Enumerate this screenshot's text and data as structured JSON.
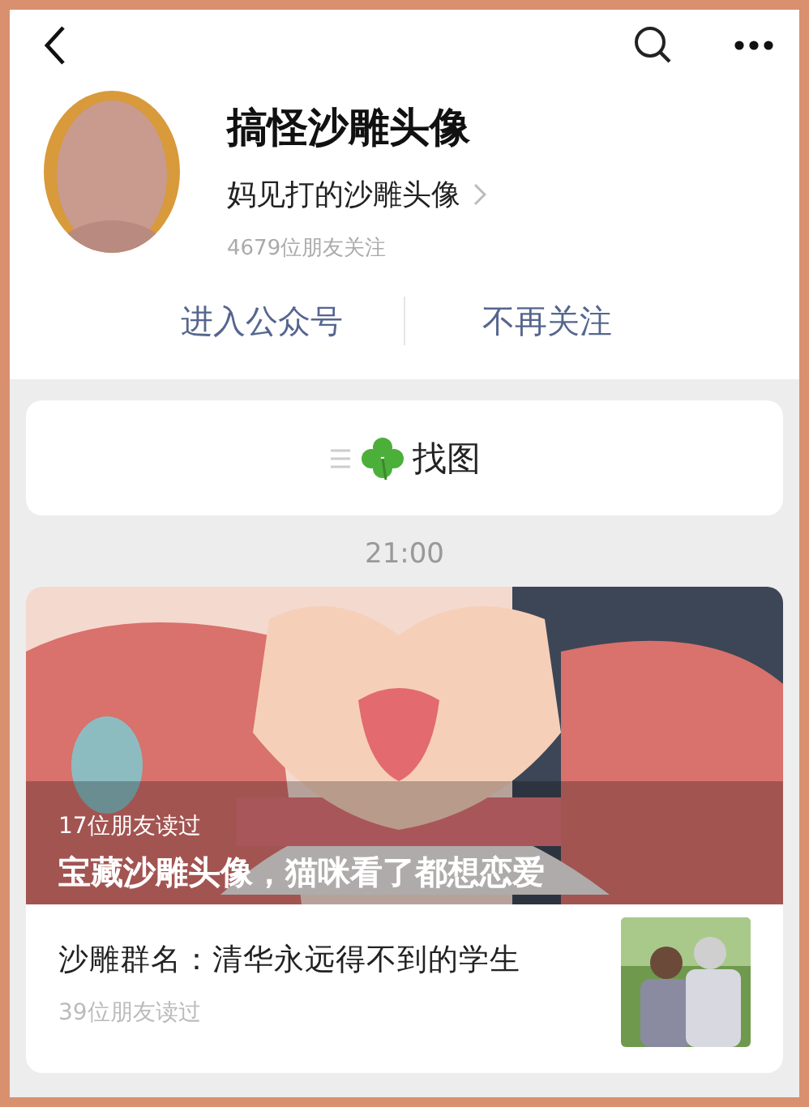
{
  "account": {
    "name": "搞怪沙雕头像",
    "description": "妈见打的沙雕头像",
    "followers": "4679位朋友关注"
  },
  "actions": [
    {
      "label": "进入公众号"
    },
    {
      "label": "不再关注"
    }
  ],
  "menu": {
    "label": "找图"
  },
  "time": "21:00",
  "articles": [
    {
      "kind": "cover",
      "reads": "17位朋友读过",
      "title": "宝藏沙雕头像，猫咪看了都想恋爱"
    },
    {
      "kind": "row",
      "title": "沙雕群名：清华永远得不到的学生",
      "reads": "39位朋友读过"
    }
  ]
}
